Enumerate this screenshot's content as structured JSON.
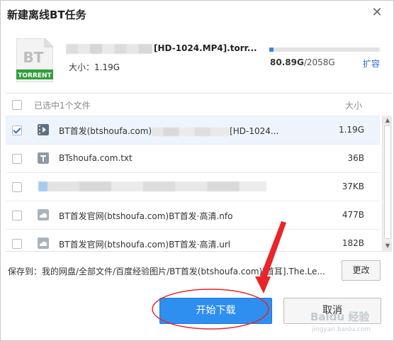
{
  "dialog": {
    "title": "新建离线BT任务",
    "close_glyph": "✕"
  },
  "torrent": {
    "icon_label_top": "BT",
    "icon_label_bottom": "TORRENT",
    "name_visible": "[HD-1024.MP4].torr...",
    "size": "大小：1.19G"
  },
  "space": {
    "used": "80.89G",
    "total": "/2058G",
    "used_fraction": 0.039,
    "expand_label": "扩容"
  },
  "list": {
    "header_label": "已选中1个文件",
    "header_size": "大小",
    "rows": [
      {
        "name_prefix": "BT首发(btshoufa.com)",
        "name_suffix": "[HD-1024...",
        "size": "1.19G",
        "checked": true
      },
      {
        "name": "BTshoufa.com.txt",
        "size": "36B",
        "checked": false
      },
      {
        "size": "37KB",
        "checked": false
      },
      {
        "name": "BT首发官网(btshoufa.com)BT首发·高清.nfo",
        "size": "477B",
        "checked": false
      },
      {
        "name": "BT首发官网(btshoufa.com)BT首发·高清.url",
        "size": "182B",
        "checked": false
      }
    ]
  },
  "save": {
    "label": "保存到：",
    "path": "我的网盘/全部文件/百度经验图片/BT首发(btshoufa.com)[首耳].The.Le...",
    "change_label": "更改"
  },
  "buttons": {
    "start_label": "开始下载",
    "cancel_label": "取消"
  },
  "watermark": {
    "text_top": "Baidu 经验",
    "text_bottom": "jingyan.baidu.com"
  },
  "colors": {
    "accent": "#2e8ff0",
    "annotation": "#e8262a",
    "link": "#2b6cc7"
  }
}
